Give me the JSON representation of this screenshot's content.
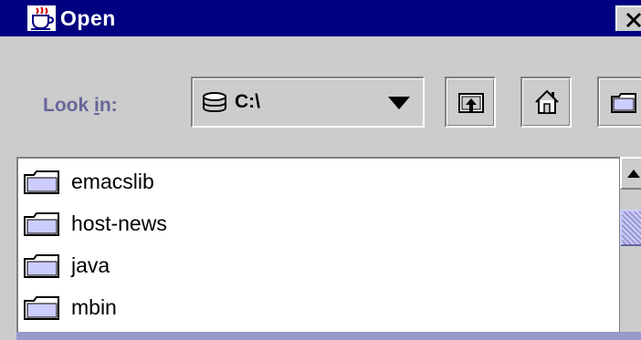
{
  "window": {
    "title": "Open",
    "close_label": "×"
  },
  "toolbar": {
    "look_in_prefix": "Look ",
    "look_in_mnemonic": "i",
    "look_in_suffix": "n:",
    "look_in_value": "C:\\",
    "buttons": [
      {
        "name": "up-one-level",
        "icon": "up-folder-icon"
      },
      {
        "name": "home",
        "icon": "home-icon"
      },
      {
        "name": "new-folder",
        "icon": "new-folder-icon"
      }
    ]
  },
  "files": [
    {
      "name": "emacslib",
      "icon": "folder-icon"
    },
    {
      "name": "host-news",
      "icon": "folder-icon"
    },
    {
      "name": "java",
      "icon": "folder-icon"
    },
    {
      "name": "mbin",
      "icon": "folder-icon"
    }
  ],
  "colors": {
    "title_bar": "#000080",
    "window_bg": "#cccccc",
    "label": "#666699",
    "scroll_thumb": "#9999cc"
  }
}
